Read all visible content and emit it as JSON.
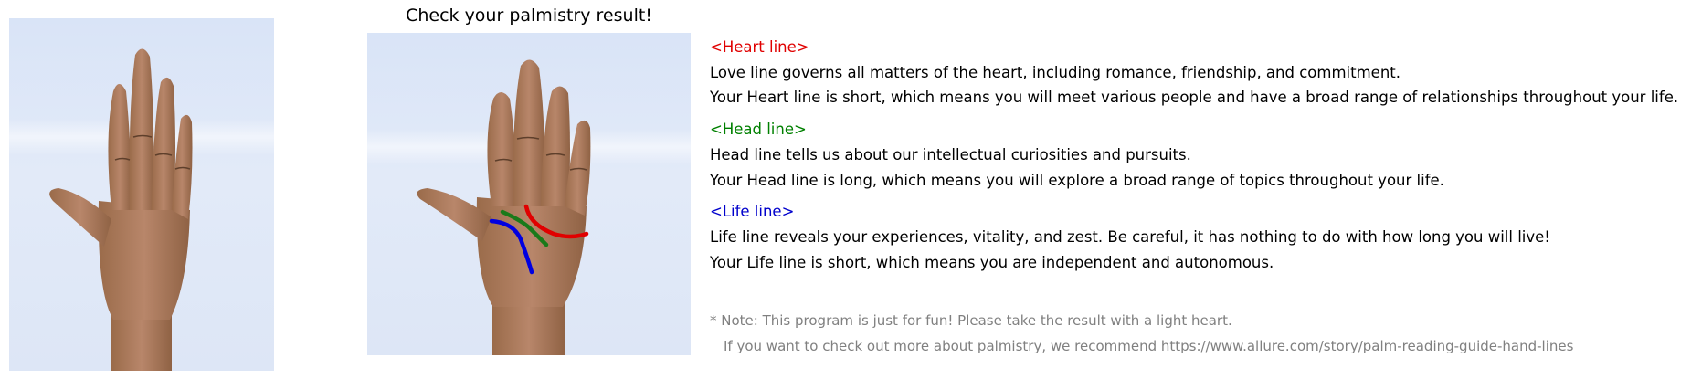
{
  "title": "Check your palmistry result!",
  "sections": [
    {
      "header": "<Heart line>",
      "color": "#e00000",
      "description": "Love line governs all matters of the heart, including romance, friendship, and commitment.",
      "result": "Your Heart line is short, which means you will meet various people and have a broad range of relationships throughout your life."
    },
    {
      "header": "<Head line>",
      "color": "#008000",
      "description": "Head line tells us about our intellectual curiosities and pursuits.",
      "result": "Your Head line is long, which means you will explore a broad range of topics throughout your life."
    },
    {
      "header": "<Life line>",
      "color": "#0000cc",
      "description": "Life line reveals your experiences, vitality, and zest. Be careful, it has nothing to do with how long you will live!",
      "result": "Your Life line is short, which means you are independent and autonomous."
    }
  ],
  "note": {
    "line1": "* Note: This program is just for fun! Please take the result with a light heart.",
    "line2": "If you want to check out more about palmistry, we recommend https://www.allure.com/story/palm-reading-guide-hand-lines"
  }
}
